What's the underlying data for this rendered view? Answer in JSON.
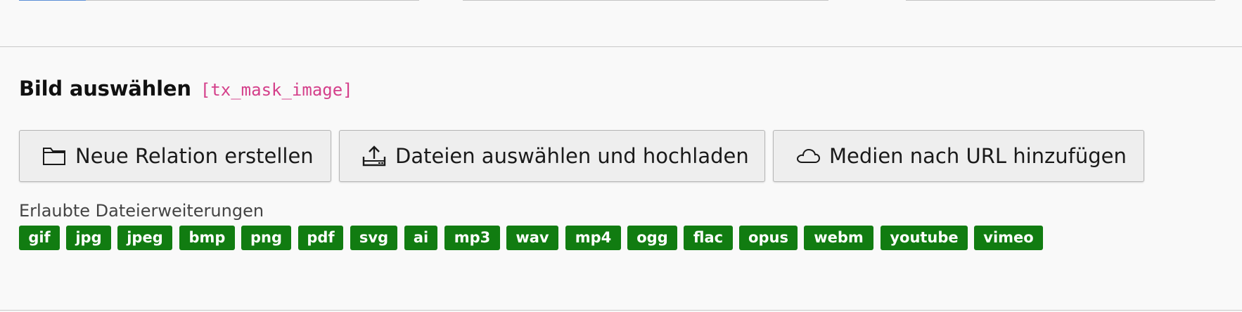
{
  "field": {
    "label": "Bild auswählen",
    "code": "[tx_mask_image]"
  },
  "buttons": {
    "new_relation": "Neue Relation erstellen",
    "upload": "Dateien auswählen und hochladen",
    "add_media_url": "Medien nach URL hinzufügen"
  },
  "icons": {
    "new_relation": "folder-icon",
    "upload": "upload-icon",
    "add_media_url": "cloud-icon"
  },
  "allowed_extensions": {
    "label": "Erlaubte Dateierweiterungen",
    "items": [
      "gif",
      "jpg",
      "jpeg",
      "bmp",
      "png",
      "pdf",
      "svg",
      "ai",
      "mp3",
      "wav",
      "mp4",
      "ogg",
      "flac",
      "opus",
      "webm",
      "youtube",
      "vimeo"
    ]
  },
  "colors": {
    "badge_bg": "#117c11",
    "code_color": "#d43f8a",
    "background": "#f9f9f9"
  }
}
